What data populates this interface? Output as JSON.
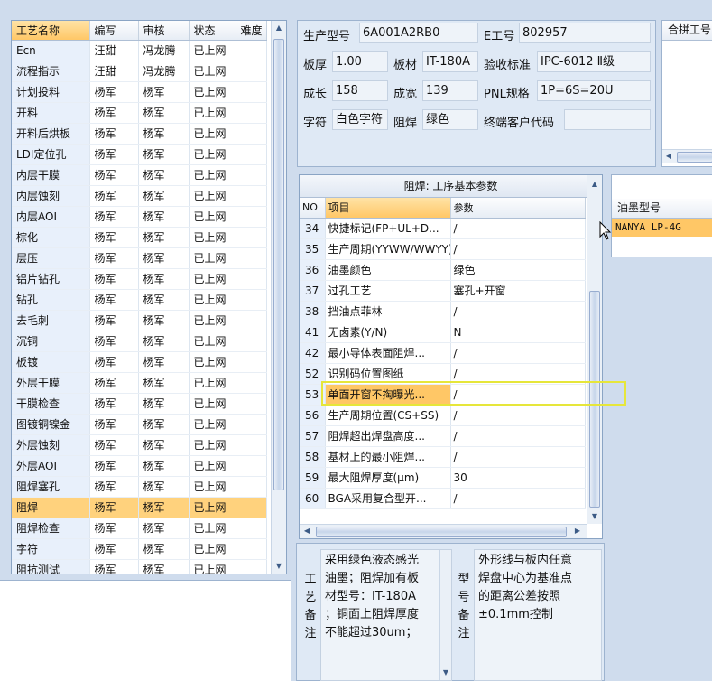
{
  "process_grid": {
    "columns": [
      "工艺名称",
      "编写",
      "审核",
      "状态",
      "难度"
    ],
    "selected_index": 22,
    "rows": [
      {
        "name": "Ecn",
        "author": "汪甜",
        "reviewer": "冯龙腾",
        "status": "已上网"
      },
      {
        "name": "流程指示",
        "author": "汪甜",
        "reviewer": "冯龙腾",
        "status": "已上网"
      },
      {
        "name": "计划投料",
        "author": "杨军",
        "reviewer": "杨军",
        "status": "已上网"
      },
      {
        "name": "开料",
        "author": "杨军",
        "reviewer": "杨军",
        "status": "已上网"
      },
      {
        "name": "开料后烘板",
        "author": "杨军",
        "reviewer": "杨军",
        "status": "已上网"
      },
      {
        "name": "LDI定位孔",
        "author": "杨军",
        "reviewer": "杨军",
        "status": "已上网"
      },
      {
        "name": "内层干膜",
        "author": "杨军",
        "reviewer": "杨军",
        "status": "已上网"
      },
      {
        "name": "内层蚀刻",
        "author": "杨军",
        "reviewer": "杨军",
        "status": "已上网"
      },
      {
        "name": "内层AOI",
        "author": "杨军",
        "reviewer": "杨军",
        "status": "已上网"
      },
      {
        "name": "棕化",
        "author": "杨军",
        "reviewer": "杨军",
        "status": "已上网"
      },
      {
        "name": "层压",
        "author": "杨军",
        "reviewer": "杨军",
        "status": "已上网"
      },
      {
        "name": "铝片钻孔",
        "author": "杨军",
        "reviewer": "杨军",
        "status": "已上网"
      },
      {
        "name": "钻孔",
        "author": "杨军",
        "reviewer": "杨军",
        "status": "已上网"
      },
      {
        "name": "去毛刺",
        "author": "杨军",
        "reviewer": "杨军",
        "status": "已上网"
      },
      {
        "name": "沉铜",
        "author": "杨军",
        "reviewer": "杨军",
        "status": "已上网"
      },
      {
        "name": "板镀",
        "author": "杨军",
        "reviewer": "杨军",
        "status": "已上网"
      },
      {
        "name": "外层干膜",
        "author": "杨军",
        "reviewer": "杨军",
        "status": "已上网"
      },
      {
        "name": "干膜检查",
        "author": "杨军",
        "reviewer": "杨军",
        "status": "已上网"
      },
      {
        "name": "图镀铜镍金",
        "author": "杨军",
        "reviewer": "杨军",
        "status": "已上网"
      },
      {
        "name": "外层蚀刻",
        "author": "杨军",
        "reviewer": "杨军",
        "status": "已上网"
      },
      {
        "name": "外层AOI",
        "author": "杨军",
        "reviewer": "杨军",
        "status": "已上网"
      },
      {
        "name": "阻焊塞孔",
        "author": "杨军",
        "reviewer": "杨军",
        "status": "已上网"
      },
      {
        "name": "阻焊",
        "author": "杨军",
        "reviewer": "杨军",
        "status": "已上网"
      },
      {
        "name": "阻焊检查",
        "author": "杨军",
        "reviewer": "杨军",
        "status": "已上网"
      },
      {
        "name": "字符",
        "author": "杨军",
        "reviewer": "杨军",
        "status": "已上网"
      },
      {
        "name": "阻抗测试",
        "author": "杨军",
        "reviewer": "杨军",
        "status": "已上网"
      }
    ]
  },
  "info": {
    "model_label": "生产型号",
    "model_value": "6A001A2RB0",
    "eno_label": "E工号",
    "eno_value": "802957",
    "thickness_label": "板厚",
    "thickness_value": "1.00",
    "material_label": "板材",
    "material_value": "IT-180A",
    "standard_label": "验收标准",
    "standard_value": "IPC-6012 Ⅱ级",
    "length_label": "成长",
    "length_value": "158",
    "width_label": "成宽",
    "width_value": "139",
    "pnl_label": "PNL规格",
    "pnl_value": "1P=6S=20U",
    "char_label": "字符",
    "char_value": "白色字符",
    "mask_label": "阻焊",
    "mask_value": "绿色",
    "customer_label": "终端客户代码",
    "customer_value": ""
  },
  "combine": {
    "header": "合拼工号"
  },
  "param_grid": {
    "title": "阻焊: 工序基本参数",
    "columns": [
      "NO",
      "项目",
      "参数"
    ],
    "selected_index": 8,
    "rows": [
      {
        "no": "34",
        "item": "快捷标记(FP+UL+D...",
        "value": "/"
      },
      {
        "no": "35",
        "item": "生产周期(YYWW/WWYY)",
        "value": "/"
      },
      {
        "no": "36",
        "item": "油墨颜色",
        "value": "绿色"
      },
      {
        "no": "37",
        "item": "过孔工艺",
        "value": "塞孔+开窗"
      },
      {
        "no": "38",
        "item": "挡油点菲林",
        "value": "/"
      },
      {
        "no": "41",
        "item": "无卤素(Y/N)",
        "value": "N"
      },
      {
        "no": "42",
        "item": "最小导体表面阻焊...",
        "value": "/"
      },
      {
        "no": "52",
        "item": "识别码位置图纸",
        "value": "/"
      },
      {
        "no": "53",
        "item": "单面开窗不掏曝光...",
        "value": "/"
      },
      {
        "no": "56",
        "item": "生产周期位置(CS+SS)",
        "value": "/"
      },
      {
        "no": "57",
        "item": "阻焊超出焊盘高度...",
        "value": "/"
      },
      {
        "no": "58",
        "item": "基材上的最小阻焊...",
        "value": "/"
      },
      {
        "no": "59",
        "item": "最大阻焊厚度(μm)",
        "value": "30"
      },
      {
        "no": "60",
        "item": "BGA采用复合型开...",
        "value": "/"
      }
    ]
  },
  "ink": {
    "header": "油墨型号",
    "row": "NANYA LP-4G"
  },
  "remarks": {
    "process_label": [
      "工",
      "艺",
      "备",
      "注"
    ],
    "process_text": [
      "采用绿色液态感光",
      "油墨；阻焊加有板",
      "材型号：IT-180A",
      "；铜面上阻焊厚度",
      "不能超过30um；"
    ],
    "type_label": [
      "型",
      "号",
      "备",
      "注"
    ],
    "type_text": [
      "外形线与板内任意",
      "焊盘中心为基准点",
      "的距离公差按照",
      "±0.1mm控制"
    ]
  },
  "icons": {
    "scroll_up": "arrow-up-icon",
    "scroll_down": "arrow-down-icon",
    "scroll_left": "arrow-left-icon",
    "scroll_right": "arrow-right-icon",
    "cursor": "mouse-pointer-icon"
  }
}
